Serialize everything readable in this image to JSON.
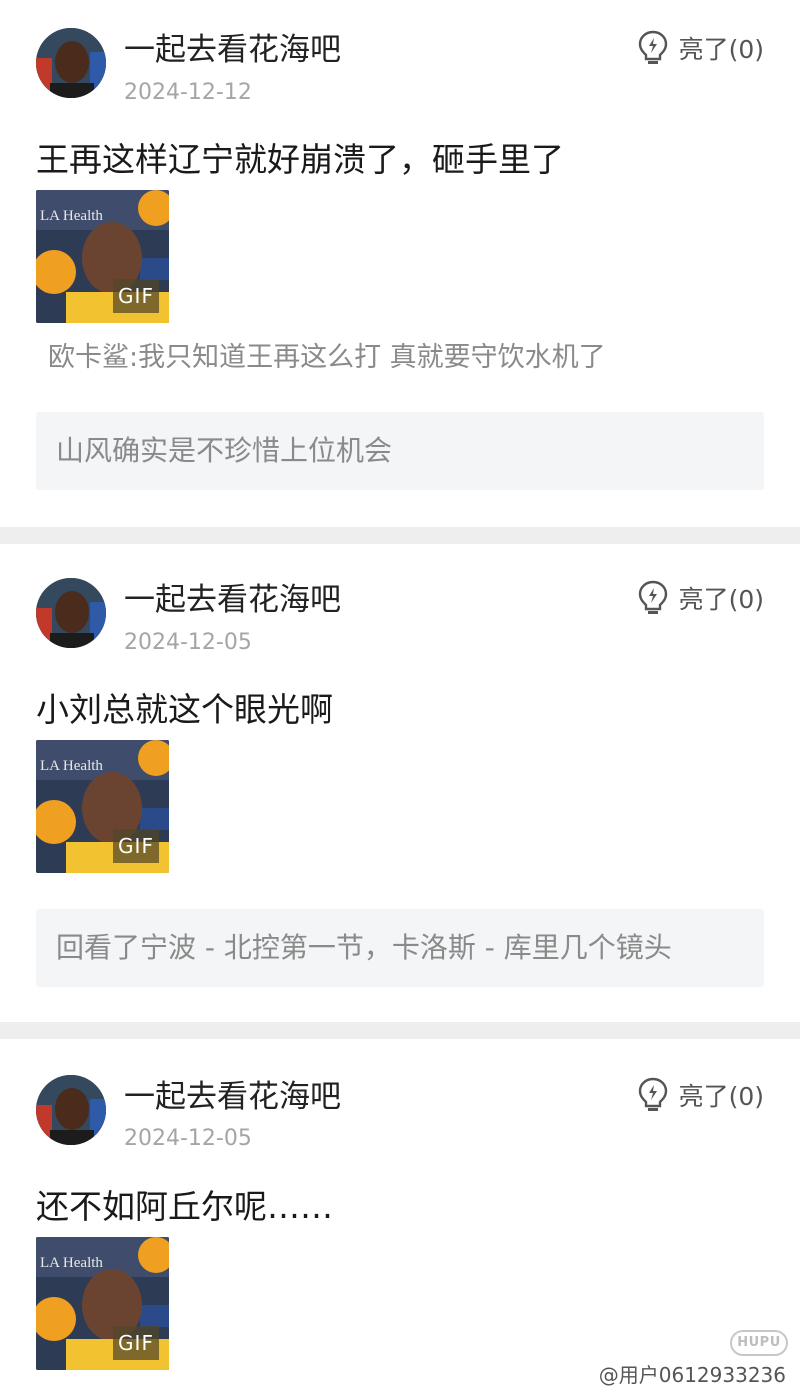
{
  "posts": [
    {
      "username": "一起去看花海吧",
      "date": "2024-12-12",
      "like_label": "亮了(0)",
      "content": "王再这样辽宁就好崩溃了，砸手里了",
      "gif_badge": "GIF",
      "reply_inline": "欧卡鲨:我只知道王再这么打 真就要守饮水机了",
      "quote": "山风确实是不珍惜上位机会"
    },
    {
      "username": "一起去看花海吧",
      "date": "2024-12-05",
      "like_label": "亮了(0)",
      "content": "小刘总就这个眼光啊",
      "gif_badge": "GIF",
      "quote": "回看了宁波 - 北控第一节，卡洛斯 - 库里几个镜头"
    },
    {
      "username": "一起去看花海吧",
      "date": "2024-12-05",
      "like_label": "亮了(0)",
      "content": "还不如阿丘尔呢……",
      "gif_badge": "GIF"
    }
  ],
  "watermark": "@用户0612933236",
  "logo_text": "HUPU",
  "colors": {
    "accent": "#d7262e",
    "divider": "#eeeeee",
    "quote_bg": "#f4f5f7",
    "muted_text": "#8a8a8a"
  }
}
